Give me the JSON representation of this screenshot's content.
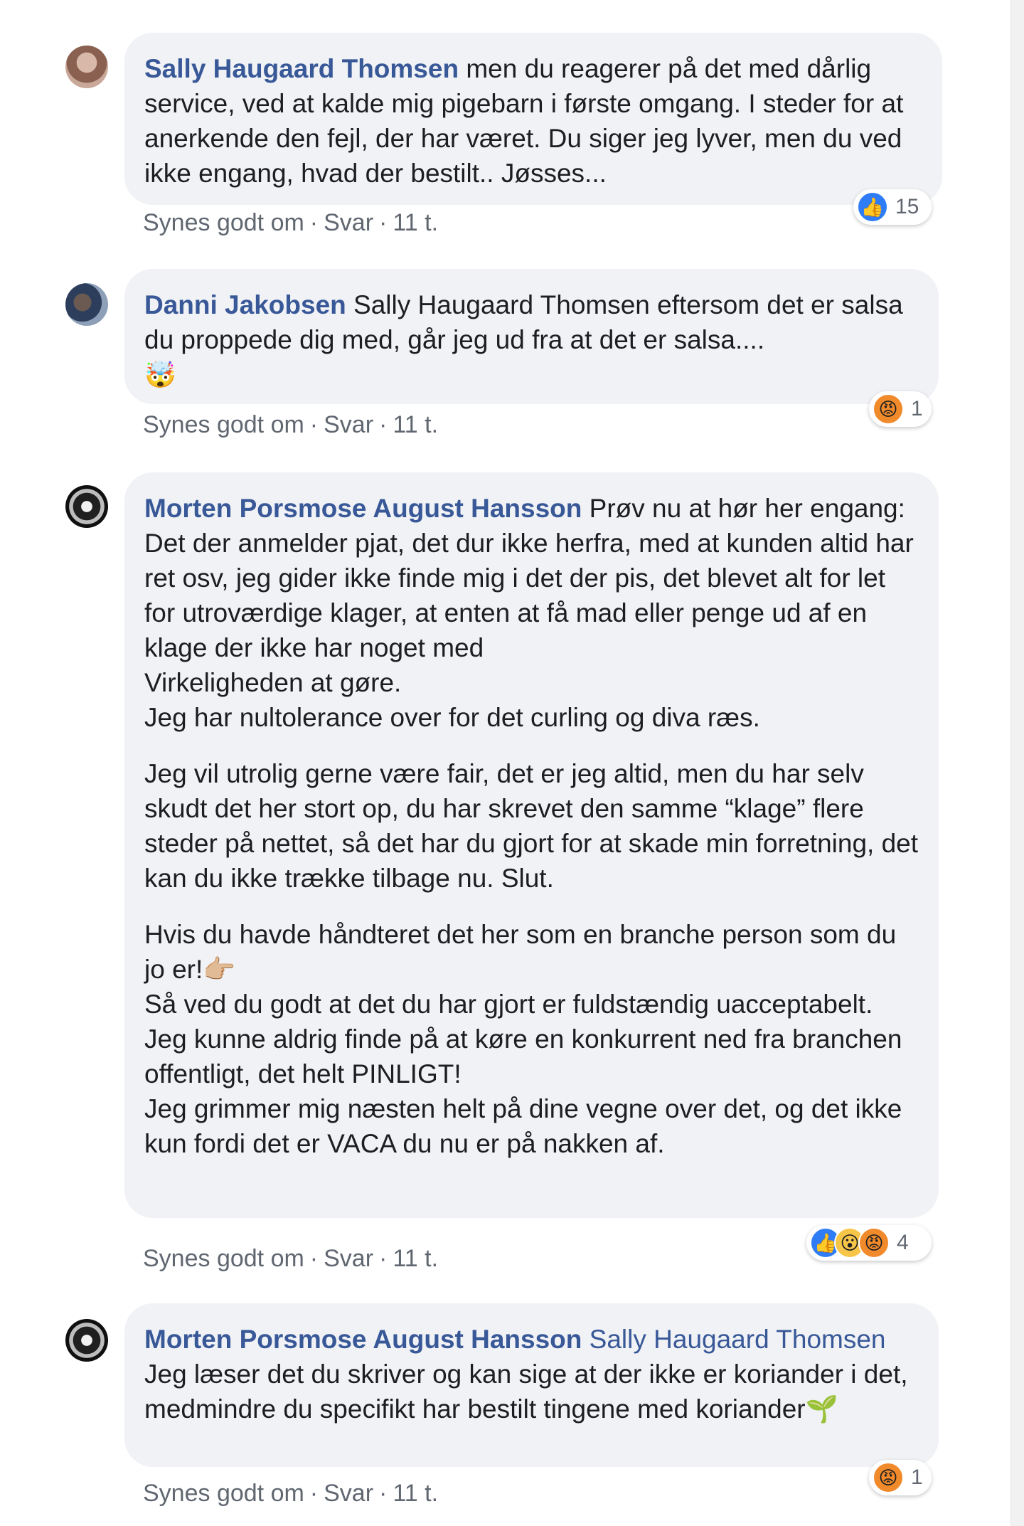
{
  "comments": [
    {
      "author": "Sally Haugaard Thomsen",
      "mention": "",
      "paragraphs": [
        [
          "men du reagerer på det med dårlig service, ved at kalde mig pigebarn i første omgang. I steder for at anerkende den fejl, der har været. Du siger jeg lyver, men du ved ikke engang, hvad der bestilt.. Jøsses..."
        ]
      ],
      "actions": {
        "like": "Synes godt om",
        "reply": "Svar",
        "time": "11 t."
      },
      "reactions": {
        "icons": [
          "like"
        ],
        "count": "15"
      }
    },
    {
      "author": "Danni Jakobsen",
      "mention": "Sally Haugaard Thomsen",
      "paragraphs": [
        [
          "eftersom det er salsa du proppede dig med, går jeg ud fra at det er salsa...."
        ]
      ],
      "emoji_line": "🤯",
      "actions": {
        "like": "Synes godt om",
        "reply": "Svar",
        "time": "11 t."
      },
      "reactions": {
        "icons": [
          "angry"
        ],
        "count": "1"
      }
    },
    {
      "author": "Morten Porsmose August Hansson",
      "mention": "",
      "paragraphs": [
        [
          "Prøv nu at hør her engang:",
          "Det der anmelder pjat, det dur ikke herfra, med at kunden altid har ret osv, jeg gider ikke finde mig i det der pis, det blevet alt for let for utroværdige klager, at enten at få mad eller penge ud af en klage der ikke har noget med",
          "Virkeligheden at gøre.",
          "Jeg har nultolerance over for det curling og diva ræs."
        ],
        [
          "Jeg vil utrolig gerne være fair, det er jeg altid, men du har selv skudt det her stort op, du har skrevet den samme “klage” flere steder på nettet, så det har du gjort for at skade min forretning, det kan du ikke trække tilbage nu. Slut."
        ],
        [
          "Hvis du havde håndteret det her som en branche person som du jo er!👉🏼",
          "Så ved du godt at det du har gjort er fuldstændig uacceptabelt.",
          "Jeg kunne aldrig finde på at køre en konkurrent ned fra branchen offentligt, det helt PINLIGT!",
          "Jeg grimmer mig næsten helt på dine vegne over det, og det ikke kun fordi det er VACA du nu er på nakken af."
        ]
      ],
      "actions": {
        "like": "Synes godt om",
        "reply": "Svar",
        "time": "11 t."
      },
      "reactions": {
        "icons": [
          "like",
          "wow",
          "angry"
        ],
        "count": "4"
      }
    },
    {
      "author": "Morten Porsmose August Hansson",
      "mention": "Sally Haugaard Thomsen",
      "paragraphs": [
        [
          "Jeg læser det du skriver og kan sige at der ikke er koriander i det, medmindre du specifikt har bestilt tingene med koriander🌱"
        ]
      ],
      "actions": {
        "like": "Synes godt om",
        "reply": "Svar",
        "time": "11 t."
      },
      "reactions": {
        "icons": [
          "angry"
        ],
        "count": "1"
      }
    }
  ],
  "reaction_glyphs": {
    "like": "👍",
    "wow": "😮",
    "angry": "😡"
  },
  "colors": {
    "author": "#385898",
    "bubble": "#f0f2f5",
    "meta": "#606770"
  }
}
